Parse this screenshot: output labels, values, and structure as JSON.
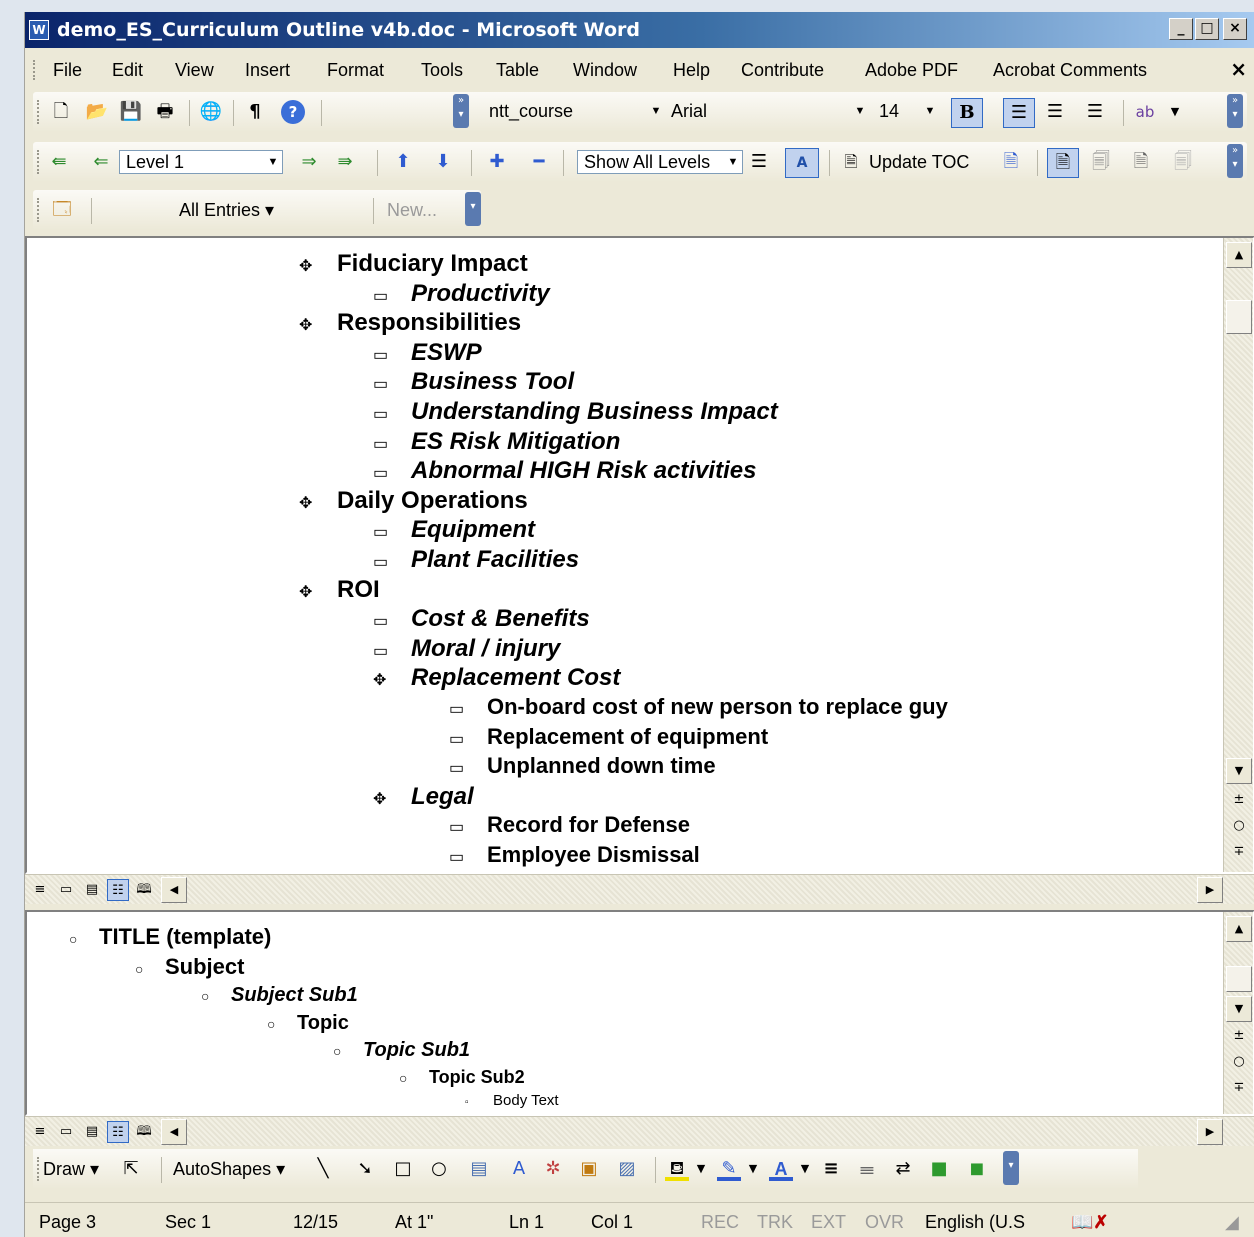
{
  "window": {
    "title": "demo_ES_Curriculum Outline v4b.doc - Microsoft Word",
    "app_icon": "W",
    "caption_minimize": "_",
    "caption_maximize": "□",
    "caption_close": "×"
  },
  "menu": {
    "items": [
      "File",
      "Edit",
      "View",
      "Insert",
      "Format",
      "Tools",
      "Table",
      "Window",
      "Help",
      "Contribute",
      "Adobe PDF",
      "Acrobat Comments"
    ],
    "close": "×"
  },
  "formatting": {
    "style": "ntt_course",
    "font": "Arial",
    "size": "14",
    "bold_label": "B",
    "pilcrow": "¶",
    "help": "?"
  },
  "outlining": {
    "level": "Level 1",
    "show_levels": "Show All Levels",
    "update_toc": "Update TOC"
  },
  "autotext": {
    "entries": "All Entries ▾",
    "new": "New..."
  },
  "outline_main": [
    {
      "text": "Fiduciary Impact",
      "level": 0,
      "sym": "plus",
      "italic": false
    },
    {
      "text": "Productivity",
      "level": 1,
      "sym": "minus",
      "italic": true
    },
    {
      "text": "Responsibilities",
      "level": 0,
      "sym": "plus",
      "italic": false
    },
    {
      "text": "ESWP",
      "level": 1,
      "sym": "minus",
      "italic": true
    },
    {
      "text": "Business Tool",
      "level": 1,
      "sym": "minus",
      "italic": true
    },
    {
      "text": "Understanding Business Impact",
      "level": 1,
      "sym": "minus",
      "italic": true
    },
    {
      "text": "ES Risk Mitigation",
      "level": 1,
      "sym": "minus",
      "italic": true
    },
    {
      "text": "Abnormal HIGH Risk activities",
      "level": 1,
      "sym": "minus",
      "italic": true
    },
    {
      "text": "Daily Operations",
      "level": 0,
      "sym": "plus",
      "italic": false
    },
    {
      "text": "Equipment",
      "level": 1,
      "sym": "minus",
      "italic": true
    },
    {
      "text": "Plant Facilities",
      "level": 1,
      "sym": "minus",
      "italic": true
    },
    {
      "text": "ROI",
      "level": 0,
      "sym": "plus",
      "italic": false
    },
    {
      "text": "Cost & Benefits",
      "level": 1,
      "sym": "minus",
      "italic": true
    },
    {
      "text": "Moral / injury",
      "level": 1,
      "sym": "minus",
      "italic": true
    },
    {
      "text": "Replacement Cost",
      "level": 1,
      "sym": "plus",
      "italic": true
    },
    {
      "text": "On-board cost of new person to replace guy",
      "level": 2,
      "sym": "minus",
      "italic": false
    },
    {
      "text": "Replacement of equipment",
      "level": 2,
      "sym": "minus",
      "italic": false
    },
    {
      "text": "Unplanned down time",
      "level": 2,
      "sym": "minus",
      "italic": false
    },
    {
      "text": "Legal",
      "level": 1,
      "sym": "plus",
      "italic": true
    },
    {
      "text": "Record for Defense",
      "level": 2,
      "sym": "minus",
      "italic": false
    },
    {
      "text": "Employee Dismissal",
      "level": 2,
      "sym": "minus",
      "italic": false
    }
  ],
  "outline_template": [
    {
      "text": "TITLE (template)",
      "level": 0,
      "italic": false
    },
    {
      "text": "Subject",
      "level": 1,
      "italic": false
    },
    {
      "text": "Subject Sub1",
      "level": 2,
      "italic": true
    },
    {
      "text": "Topic",
      "level": 3,
      "italic": false
    },
    {
      "text": "Topic Sub1",
      "level": 4,
      "italic": true
    },
    {
      "text": "Topic Sub2",
      "level": 5,
      "italic": false
    },
    {
      "text": "Body Text",
      "level": 6,
      "italic": false
    }
  ],
  "drawing": {
    "draw": "Draw ▾",
    "autoshapes": "AutoShapes ▾"
  },
  "status": {
    "page": "Page 3",
    "sec": "Sec 1",
    "pages": "12/15",
    "at": "At 1\"",
    "ln": "Ln 1",
    "col": "Col 1",
    "rec": "REC",
    "trk": "TRK",
    "ext": "EXT",
    "ovr": "OVR",
    "language": "English (U.S"
  }
}
